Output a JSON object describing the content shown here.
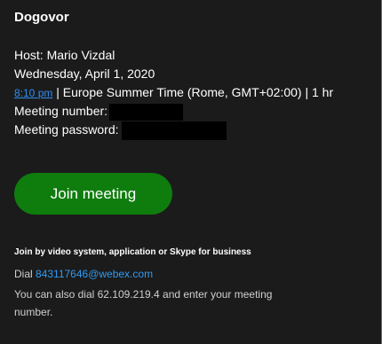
{
  "title": "Dogovor",
  "host": "Host: Mario Vizdal",
  "date": "Wednesday, April 1, 2020",
  "time": {
    "link": "8:10 pm",
    "rest": " | Europe Summer Time (Rome, GMT+02:00) | 1 hr"
  },
  "meeting_number_label": "Meeting number:",
  "meeting_password_label": "Meeting password:",
  "join_button": "Join meeting",
  "video_system": {
    "heading": "Join by video system, application or Skype for business",
    "dial_prefix": "Dial ",
    "dial_address": "843117646@webex.com",
    "alt_text": "You can also dial 62.109.219.4 and enter your meeting number."
  },
  "colors": {
    "background": "#1b1b1b",
    "button": "#0f7d0e",
    "link": "#2f8ff2"
  }
}
